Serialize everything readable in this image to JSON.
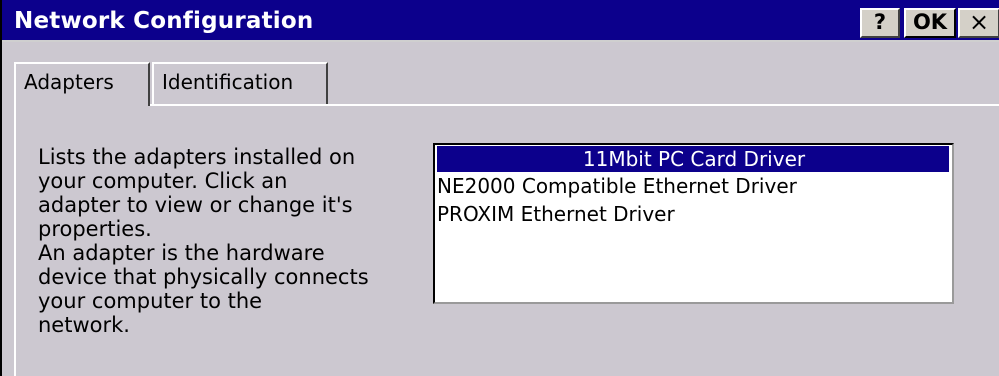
{
  "window": {
    "title": "Network Configuration",
    "help_label": "?",
    "ok_label": "OK",
    "close_label": "×"
  },
  "tabs": [
    {
      "label": "Adapters",
      "selected": true
    },
    {
      "label": "Identification",
      "selected": false
    }
  ],
  "description": {
    "paragraph1": "Lists the adapters installed on\nyour computer.  Click an\nadapter to view or change it's\nproperties.",
    "paragraph2": "An adapter is the hardware\ndevice that physically connects\nyour computer to the\nnetwork."
  },
  "adapters": [
    {
      "label": "11Mbit PC Card Driver",
      "selected": true
    },
    {
      "label": "NE2000 Compatible Ethernet Driver",
      "selected": false
    },
    {
      "label": "PROXIM Ethernet Driver",
      "selected": false
    }
  ],
  "colors": {
    "titlebar": "#0c008c",
    "dialog_bg": "#ccc8d0",
    "selection": "#0c008c"
  }
}
